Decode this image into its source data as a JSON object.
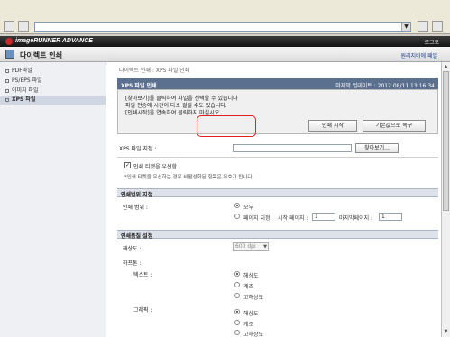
{
  "app": {
    "brand": "imageRUNNER ADVANCE",
    "top_right_link": "로그오",
    "page_title": "다이렉트 인쇄",
    "help_link": "원리지비에 패일"
  },
  "sidebar": {
    "items": [
      {
        "label": "PDF파일",
        "active": false
      },
      {
        "label": "PS/EPS 파일",
        "active": false
      },
      {
        "label": "이미지 파일",
        "active": false
      },
      {
        "label": "XPS 파일",
        "active": true
      }
    ]
  },
  "main": {
    "breadcrumb": "다이렉트 인쇄 : XPS 파일 인쇄",
    "panel": {
      "title": "XPS 파일 인쇄",
      "date": "마지막 업데이트 : 2012 08/11 13:16:34",
      "messages": [
        "[찾아보기]를 클릭하여 파일을 선택할 수 있습니다",
        "파일 전송에 시간이 다소 걸릴 수도 있습니다.",
        "[인쇄시작]을 연속하여 클릭하지 마십시오."
      ],
      "print_start": "인쇄 시작",
      "restore_default": "기본값으로 복구"
    },
    "file_path_label": "XPS 파일 지정 :",
    "file_path_value": "",
    "browse_button": "찾아보기...",
    "ticket_checkbox_label": "인쇄 티켓을 우선함",
    "ticket_checked": true,
    "ticket_note": "*인쇄 티켓을 우선하는 경우 비활성화된 항목은 무효가 됩니다.",
    "range_section": "인쇄범위 지정",
    "range_label": "인쇄 범위 :",
    "range_all": "모두",
    "range_pages": "페이지 지정",
    "range_start_label": "시작 페이지 :",
    "range_start_value": "1",
    "range_end_label": "마지막페이지 :",
    "range_end_value": "1",
    "quality_section": "인쇄품질 설정",
    "resolution_label": "해상도 :",
    "resolution_value": "600 dpi",
    "halftone_label": "하프톤 :",
    "text_label": "텍스트 :",
    "graphic_label": "그래픽 :",
    "halftone_options": [
      "해상도",
      "계조",
      "고해상도"
    ],
    "text_selected": "해상도",
    "graphic_selected": "해상도"
  },
  "colors": {
    "panel_header": "#5b6f8e",
    "highlight": "#e02020",
    "sidebar_active": "#cfd6e2"
  }
}
